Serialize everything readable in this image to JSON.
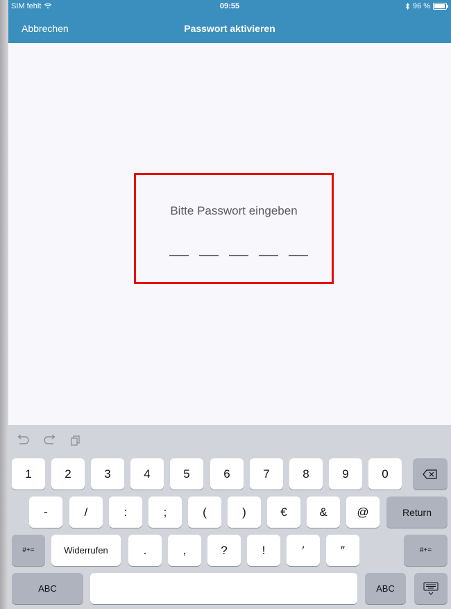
{
  "status_bar": {
    "carrier": "SIM fehlt",
    "time": "09:55",
    "battery": "96 %",
    "bluetooth": "bluetooth-icon"
  },
  "nav": {
    "cancel_label": "Abbrechen",
    "title": "Passwort aktivieren"
  },
  "prompt": {
    "text": "Bitte Passwort eingeben",
    "pin_length": 5
  },
  "toolbar": {
    "undo_icon": "undo-icon",
    "redo_icon": "redo-icon",
    "paste_icon": "paste-icon"
  },
  "keyboard": {
    "row1": [
      "1",
      "2",
      "3",
      "4",
      "5",
      "6",
      "7",
      "8",
      "9",
      "0"
    ],
    "row2": [
      "-",
      "/",
      ":",
      ";",
      "(",
      ")",
      "€",
      "&",
      "@"
    ],
    "return_label": "Return",
    "row3": [
      ".",
      ",",
      "?",
      "!",
      "′",
      "″"
    ],
    "symbols_label": "#+=",
    "undo_label": "Widerrufen",
    "abc_label": "ABC"
  }
}
